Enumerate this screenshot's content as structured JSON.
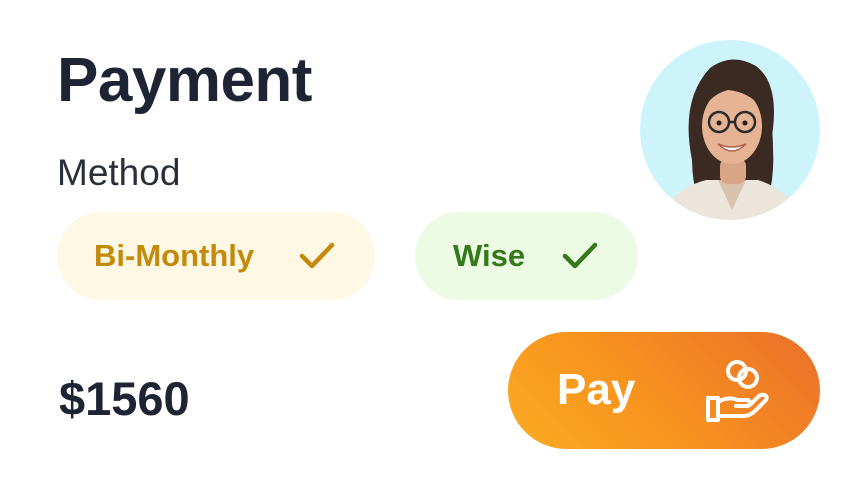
{
  "header": {
    "title": "Payment",
    "subtitle": "Method"
  },
  "avatar": {
    "background_color": "#cdf3fb"
  },
  "options": [
    {
      "label": "Bi-Monthly",
      "icon": "checkmark-icon",
      "text_color": "#c38a0b",
      "background_color": "#fef8e4"
    },
    {
      "label": "Wise",
      "icon": "checkmark-icon",
      "text_color": "#36791b",
      "background_color": "#edfbe4"
    }
  ],
  "amount": "$1560",
  "pay_button": {
    "label": "Pay",
    "icon": "hand-coins-icon",
    "gradient_colors": [
      "#ea6f2a",
      "#fbab22"
    ]
  }
}
